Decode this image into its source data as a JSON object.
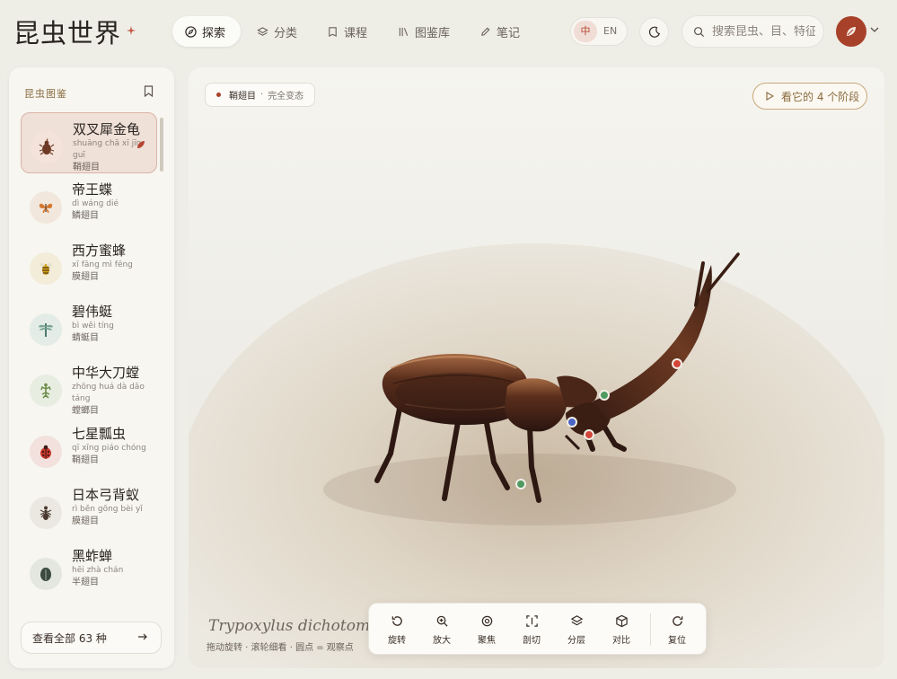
{
  "app": {
    "title": "昆虫世界"
  },
  "nav": [
    {
      "label": "探索",
      "icon": "compass-icon",
      "active": true
    },
    {
      "label": "分类",
      "icon": "layers-icon"
    },
    {
      "label": "课程",
      "icon": "book-icon"
    },
    {
      "label": "图鉴库",
      "icon": "library-icon"
    },
    {
      "label": "笔记",
      "icon": "pen-icon"
    }
  ],
  "lang": {
    "zh": "中",
    "en": "EN"
  },
  "search": {
    "placeholder": "搜索昆虫、目、特征"
  },
  "sidebar": {
    "heading": "昆虫图鉴",
    "items": [
      {
        "name": "双叉犀金龟",
        "pinyin": "shuāng chā xī jīn guī",
        "order": "鞘翅目",
        "selected": true
      },
      {
        "name": "帝王蝶",
        "pinyin": "dì wáng dié",
        "order": "鳞翅目"
      },
      {
        "name": "西方蜜蜂",
        "pinyin": "xī fāng mì fēng",
        "order": "膜翅目"
      },
      {
        "name": "碧伟蜓",
        "pinyin": "bì wěi tíng",
        "order": "蜻蜓目"
      },
      {
        "name": "中华大刀螳",
        "pinyin": "zhōng huá dà dāo táng",
        "order": "螳螂目"
      },
      {
        "name": "七星瓢虫",
        "pinyin": "qī xīng piáo chóng",
        "order": "鞘翅目"
      },
      {
        "name": "日本弓背蚁",
        "pinyin": "rì běn gōng bèi yǐ",
        "order": "膜翅目"
      },
      {
        "name": "黑蚱蝉",
        "pinyin": "hēi zhà chán",
        "order": "半翅目"
      }
    ],
    "view_all": "查看全部 63 种"
  },
  "viewer": {
    "tag_order": "鞘翅目",
    "tag_meta": "完全变态",
    "stages_button": "看它的 4 个阶段",
    "latin_name": "Trypoxylus dichotomus",
    "hint": "拖动旋转 · 滚轮细看 · 圆点 = 观察点"
  },
  "toolbar": [
    {
      "label": "旋转",
      "icon": "rotate-icon"
    },
    {
      "label": "放大",
      "icon": "zoom-in-icon"
    },
    {
      "label": "聚焦",
      "icon": "focus-icon"
    },
    {
      "label": "剖切",
      "icon": "section-icon"
    },
    {
      "label": "分层",
      "icon": "layers-icon"
    },
    {
      "label": "对比",
      "icon": "cube-icon"
    },
    {
      "label": "复位",
      "icon": "reset-icon"
    }
  ],
  "colors": {
    "accent": "#a8412a",
    "gold": "#8a6b3e",
    "background": "#eeeee7"
  }
}
